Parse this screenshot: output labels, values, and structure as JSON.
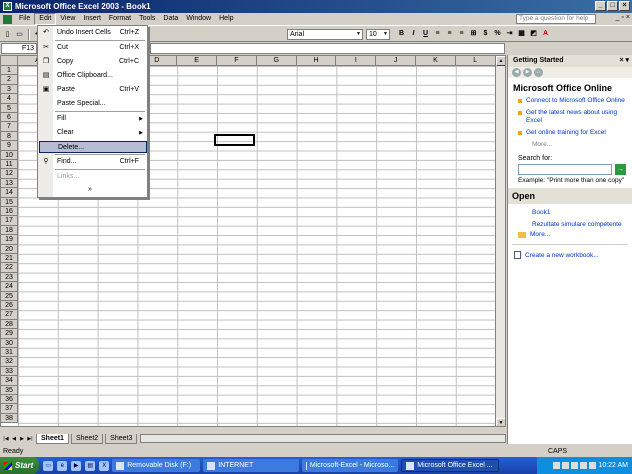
{
  "window": {
    "title": "Microsoft Office Excel 2003 - Book1"
  },
  "menubar": {
    "items": [
      "File",
      "Edit",
      "View",
      "Insert",
      "Format",
      "Tools",
      "Data",
      "Window",
      "Help"
    ],
    "help_placeholder": "Type a question for help"
  },
  "toolbar": {
    "font": "Arial",
    "size": "10"
  },
  "formula_bar": {
    "name_box": "F13"
  },
  "sheet": {
    "columns": [
      "A",
      "B",
      "C",
      "D",
      "E",
      "F",
      "G",
      "H",
      "I",
      "J",
      "K",
      "L"
    ],
    "rows": [
      "1",
      "2",
      "3",
      "4",
      "5",
      "6",
      "7",
      "8",
      "9",
      "10",
      "11",
      "12",
      "13",
      "14",
      "15",
      "16",
      "17",
      "18",
      "19",
      "20",
      "21",
      "22",
      "23",
      "24",
      "25",
      "26",
      "27",
      "28",
      "29",
      "30",
      "31",
      "32",
      "33",
      "34",
      "35",
      "36",
      "37",
      "38"
    ],
    "tabs": [
      "Sheet1",
      "Sheet2",
      "Sheet3"
    ]
  },
  "edit_menu": {
    "items": [
      {
        "label": "Undo Insert Cells",
        "shortcut": "Ctrl+Z"
      },
      {
        "label": "Cut",
        "shortcut": "Ctrl+X"
      },
      {
        "label": "Copy",
        "shortcut": "Ctrl+C"
      },
      {
        "label": "Office Clipboard...",
        "shortcut": ""
      },
      {
        "label": "Paste",
        "shortcut": "Ctrl+V"
      },
      {
        "label": "Paste Special...",
        "shortcut": ""
      },
      {
        "label": "Fill",
        "shortcut": ""
      },
      {
        "label": "Clear",
        "shortcut": ""
      },
      {
        "label": "Delete...",
        "shortcut": ""
      },
      {
        "label": "Find...",
        "shortcut": "Ctrl+F"
      },
      {
        "label": "Links...",
        "shortcut": ""
      }
    ]
  },
  "taskpane": {
    "header": "Getting Started",
    "online_title": "Microsoft Office Online",
    "links": [
      "Connect to Microsoft Office Online",
      "Get the latest news about using Excel",
      "Get online training for Excel"
    ],
    "more": "More...",
    "search_label": "Search for:",
    "example": "Example:  \"Print more than one copy\"",
    "open_title": "Open",
    "open_files": [
      "Book1",
      "Rezultate simulare competente"
    ],
    "open_more": "More...",
    "new_workbook": "Create a new workbook..."
  },
  "status": {
    "text": "Ready",
    "caps": "CAPS"
  },
  "taskbar": {
    "start": "Start",
    "buttons": [
      "Removable Disk (F:)",
      "INTERNET",
      "Microsoft-Excel - Microso...",
      "Microsoft Office Excel ..."
    ],
    "clock": "10:22 AM"
  }
}
